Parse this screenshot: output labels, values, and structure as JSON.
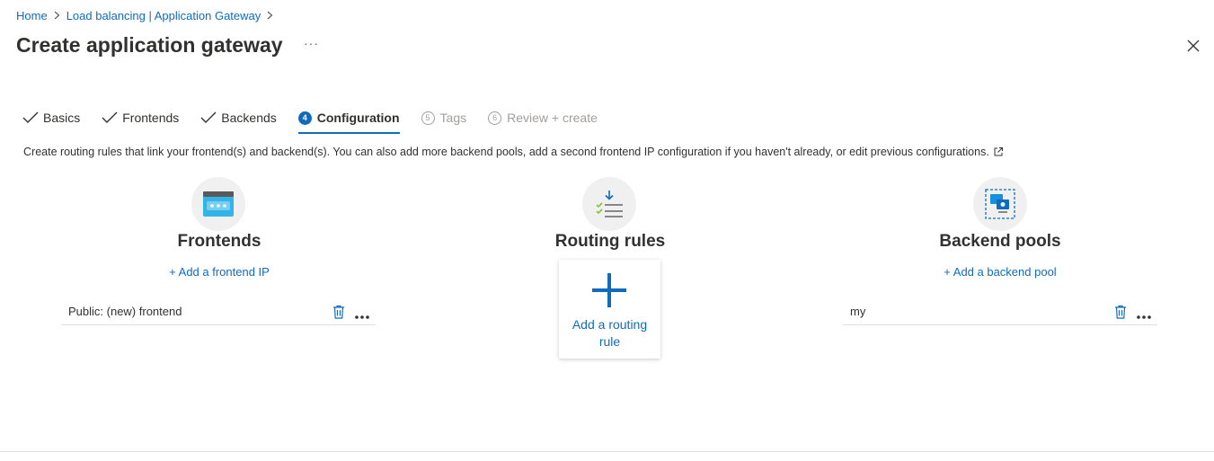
{
  "breadcrumb": [
    {
      "label": "Home"
    },
    {
      "label": "Load balancing | Application Gateway"
    }
  ],
  "page": {
    "title": "Create application gateway",
    "more": "···"
  },
  "tabs": [
    {
      "label": "Basics",
      "state": "complete"
    },
    {
      "label": "Frontends",
      "state": "complete"
    },
    {
      "label": "Backends",
      "state": "complete"
    },
    {
      "label": "Configuration",
      "number": "4",
      "state": "active"
    },
    {
      "label": "Tags",
      "number": "5",
      "state": "disabled"
    },
    {
      "label": "Review + create",
      "number": "6",
      "state": "disabled"
    }
  ],
  "description": "Create routing rules that link your frontend(s) and backend(s). You can also add more backend pools, add a second frontend IP configuration if you haven't already, or edit previous configurations.",
  "frontends": {
    "title": "Frontends",
    "add_label": "+ Add a frontend IP",
    "items": [
      {
        "label": "Public: (new) frontend"
      }
    ]
  },
  "routing": {
    "title": "Routing rules",
    "add_label": "Add a routing rule"
  },
  "backends": {
    "title": "Backend pools",
    "add_label": "+ Add a backend pool",
    "items": [
      {
        "label": "my"
      }
    ]
  },
  "colors": {
    "accent": "#0f6cbd",
    "text": "#323130",
    "disabled": "#a19f9d"
  }
}
